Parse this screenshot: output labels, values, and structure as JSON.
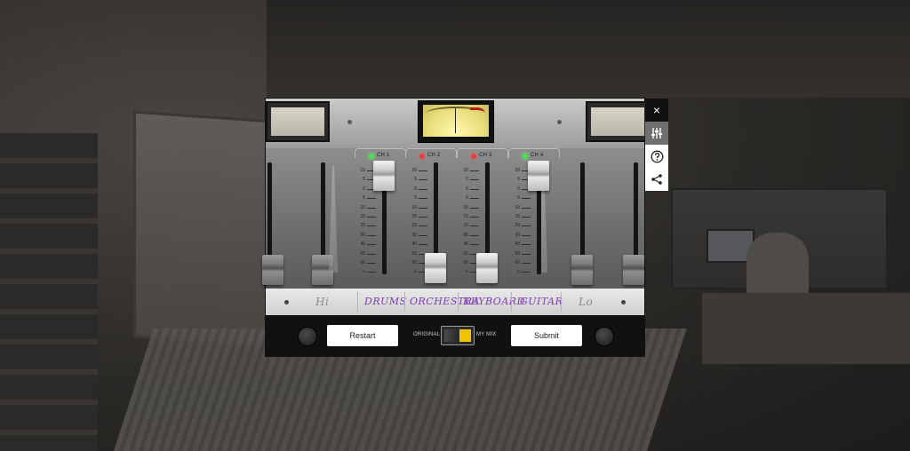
{
  "mixer": {
    "channels": [
      {
        "id": "ch1",
        "label": "CH 1",
        "led": "green",
        "name": "Drums",
        "fader_level": 0.95
      },
      {
        "id": "ch2",
        "label": "CH 2",
        "led": "red",
        "name": "Orchestra",
        "fader_level": 0.1
      },
      {
        "id": "ch3",
        "label": "CH 3",
        "led": "red",
        "name": "Keyboard",
        "fader_level": 0.1
      },
      {
        "id": "ch4",
        "label": "CH 4",
        "led": "green",
        "name": "Guitar",
        "fader_level": 0.95
      }
    ],
    "scale_labels": [
      "10",
      "5",
      "0",
      "5",
      "10",
      "15",
      "20",
      "30",
      "40",
      "50",
      "60",
      "∞"
    ],
    "hi_label": "Hi",
    "lo_label": "Lo",
    "restart_label": "Restart",
    "submit_label": "Submit",
    "toggle": {
      "left_label": "ORIGINAL",
      "right_label": "MY MIX",
      "selected": "MY MIX"
    }
  },
  "side_tools": {
    "close": "×",
    "mixer_icon": "mixer-sliders-icon",
    "help_icon": "help-icon",
    "share_icon": "share-icon"
  },
  "colors": {
    "accent": "#f0c400",
    "strip_text": "#7b3fae"
  }
}
